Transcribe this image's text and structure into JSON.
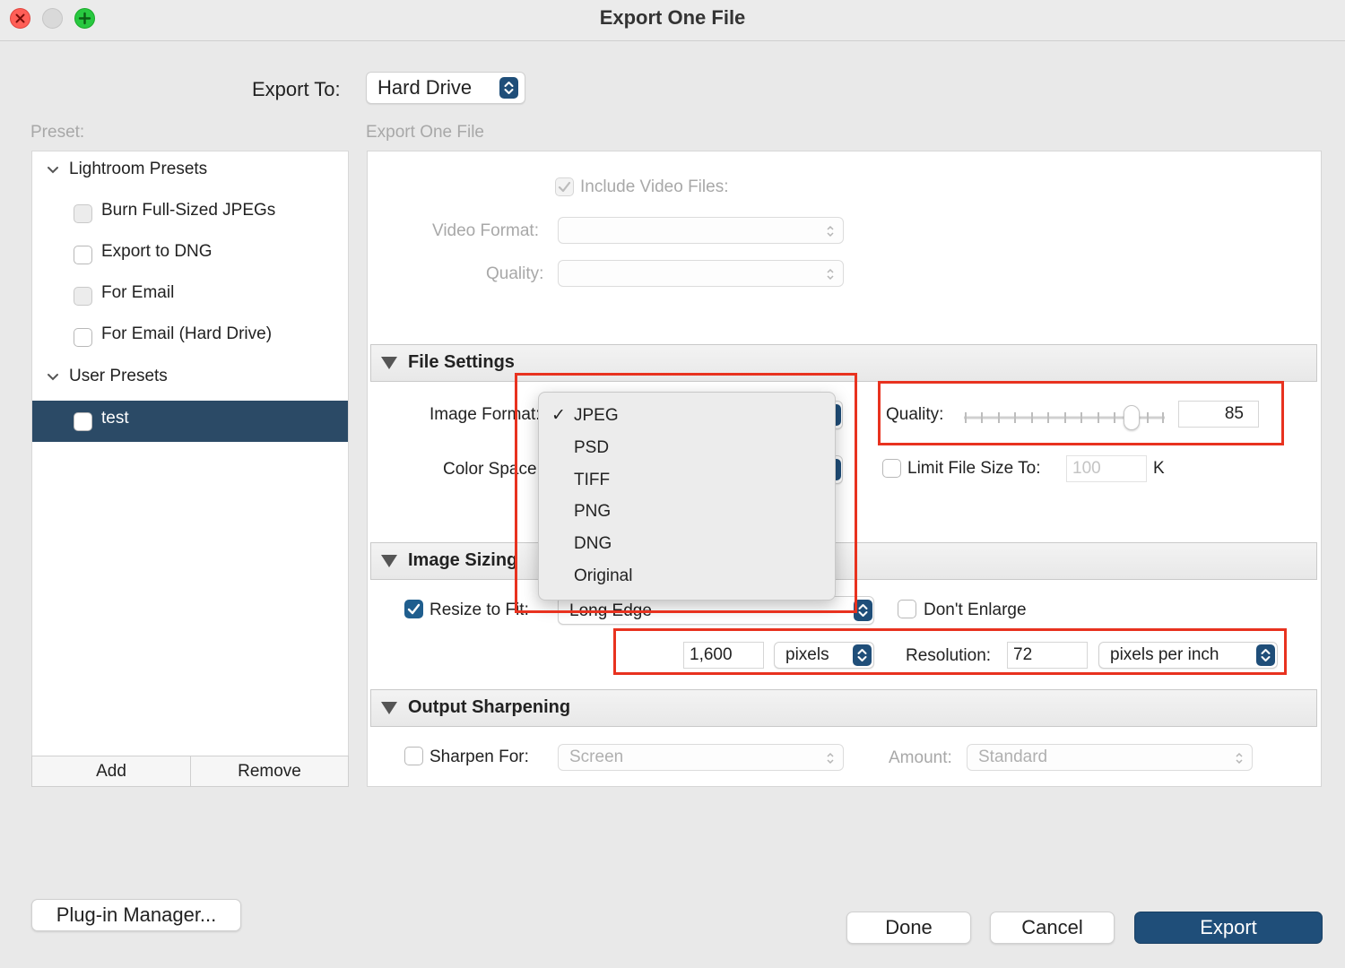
{
  "window": {
    "title": "Export One File"
  },
  "export_to": {
    "label": "Export To:",
    "value": "Hard Drive"
  },
  "preset": {
    "label": "Preset:",
    "groups": [
      {
        "name": "Lightroom Presets",
        "items": [
          "Burn Full-Sized JPEGs",
          "Export to DNG",
          "For Email",
          "For Email (Hard Drive)"
        ]
      },
      {
        "name": "User Presets",
        "items": [
          "test"
        ]
      }
    ],
    "selected": "test",
    "add_label": "Add",
    "remove_label": "Remove"
  },
  "panel": {
    "title": "Export One File",
    "include_video_label": "Include Video Files:",
    "video_format_label": "Video Format:",
    "video_quality_label": "Quality:"
  },
  "file_settings": {
    "title": "File Settings",
    "image_format_label": "Image Format:",
    "color_space_label": "Color Space:",
    "quality_label": "Quality:",
    "quality_value": "85",
    "limit_size_label": "Limit File Size To:",
    "limit_size_value": "100",
    "limit_size_unit": "K",
    "format_options": [
      "JPEG",
      "PSD",
      "TIFF",
      "PNG",
      "DNG",
      "Original"
    ],
    "format_selected": "JPEG",
    "check_glyph": "✓"
  },
  "image_sizing": {
    "title": "Image Sizing",
    "resize_label": "Resize to Fit:",
    "resize_mode": "Long Edge",
    "dont_enlarge_label": "Don't Enlarge",
    "size_value": "1,600",
    "size_unit": "pixels",
    "resolution_label": "Resolution:",
    "resolution_value": "72",
    "resolution_unit": "pixels per inch"
  },
  "output_sharpening": {
    "title": "Output Sharpening",
    "sharpen_label": "Sharpen For:",
    "sharpen_value": "Screen",
    "amount_label": "Amount:",
    "amount_value": "Standard"
  },
  "footer": {
    "plugin_manager_label": "Plug-in Manager...",
    "done_label": "Done",
    "cancel_label": "Cancel",
    "export_label": "Export"
  },
  "colors": {
    "accent": "#1f4e79",
    "selection": "#2b4a66",
    "highlight": "#e8321f"
  }
}
